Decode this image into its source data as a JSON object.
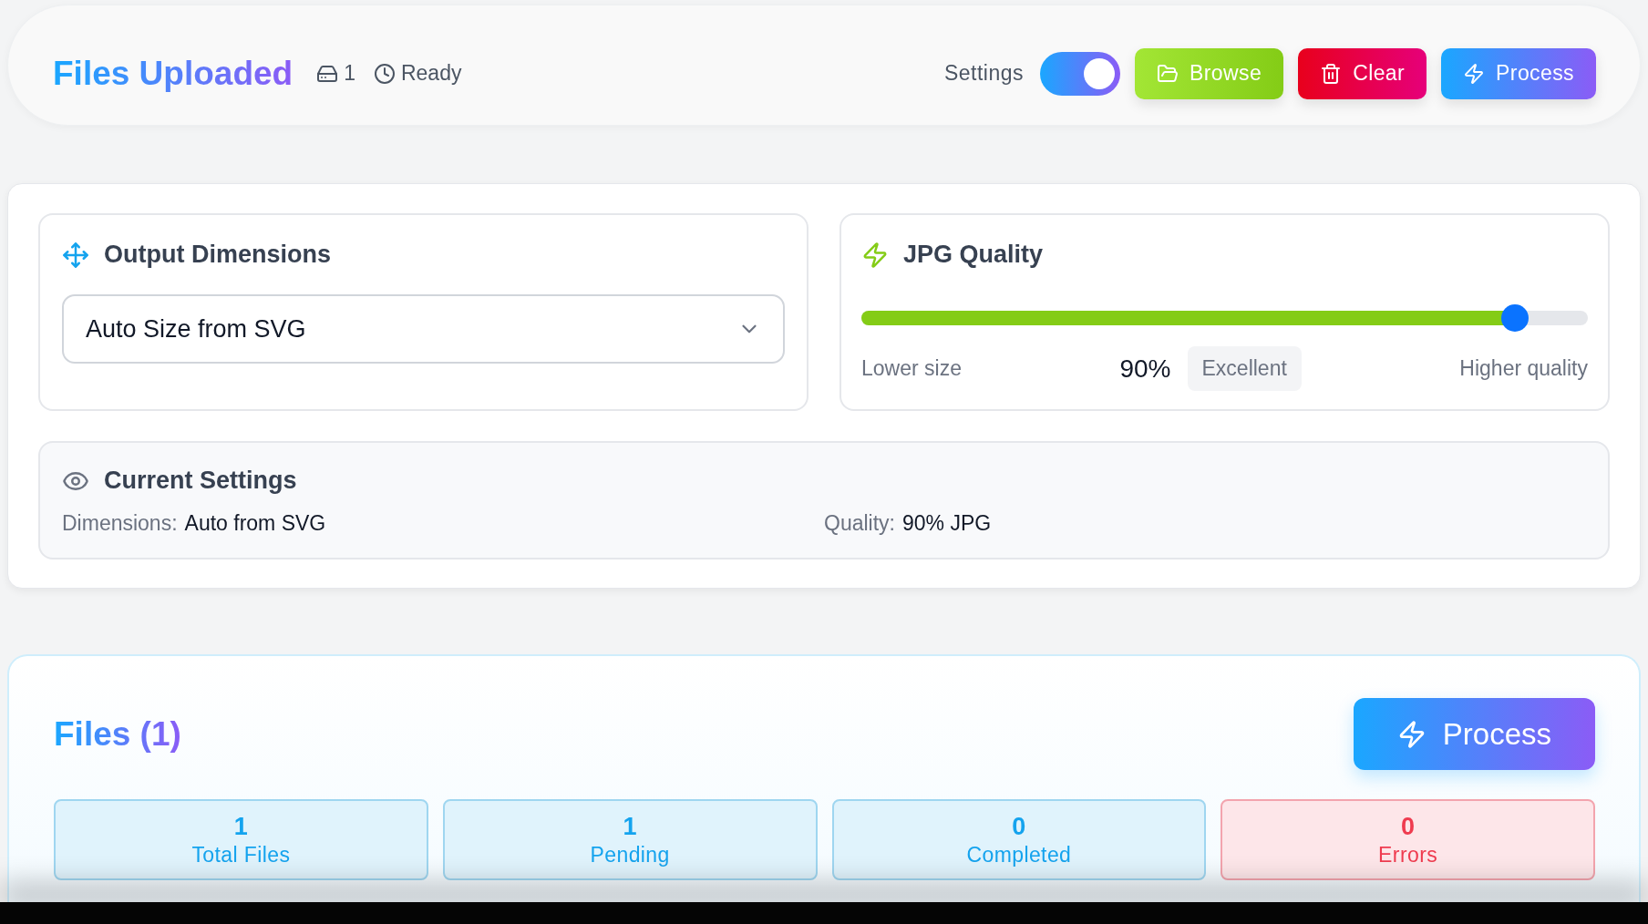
{
  "header": {
    "title": "Files Uploaded",
    "file_count": "1",
    "status": "Ready",
    "settings_label": "Settings",
    "settings_toggle": {
      "on": true
    },
    "buttons": [
      {
        "kind": "browse",
        "label": "Browse"
      },
      {
        "kind": "clear",
        "label": "Clear"
      },
      {
        "kind": "process",
        "label": "Process"
      }
    ]
  },
  "dimensions": {
    "title": "Output Dimensions",
    "select": {
      "value": "Auto Size from SVG"
    }
  },
  "quality": {
    "title": "JPG Quality",
    "slider": {
      "level": 0.9
    },
    "min_label": "Lower size",
    "value": "90%",
    "rating": "Excellent",
    "max_label": "Higher quality"
  },
  "current_settings": {
    "title": "Current Settings",
    "items": [
      {
        "label": "Dimensions:",
        "value": "Auto from SVG"
      },
      {
        "label": "Quality:",
        "value": "90% JPG"
      }
    ]
  },
  "files": {
    "title": "Files (1)",
    "process_label": "Process",
    "stats": [
      {
        "kind": "info",
        "value": "1",
        "label": "Total Files"
      },
      {
        "kind": "info",
        "value": "1",
        "label": "Pending"
      },
      {
        "kind": "info",
        "value": "0",
        "label": "Completed"
      },
      {
        "kind": "error",
        "value": "0",
        "label": "Errors"
      }
    ]
  }
}
